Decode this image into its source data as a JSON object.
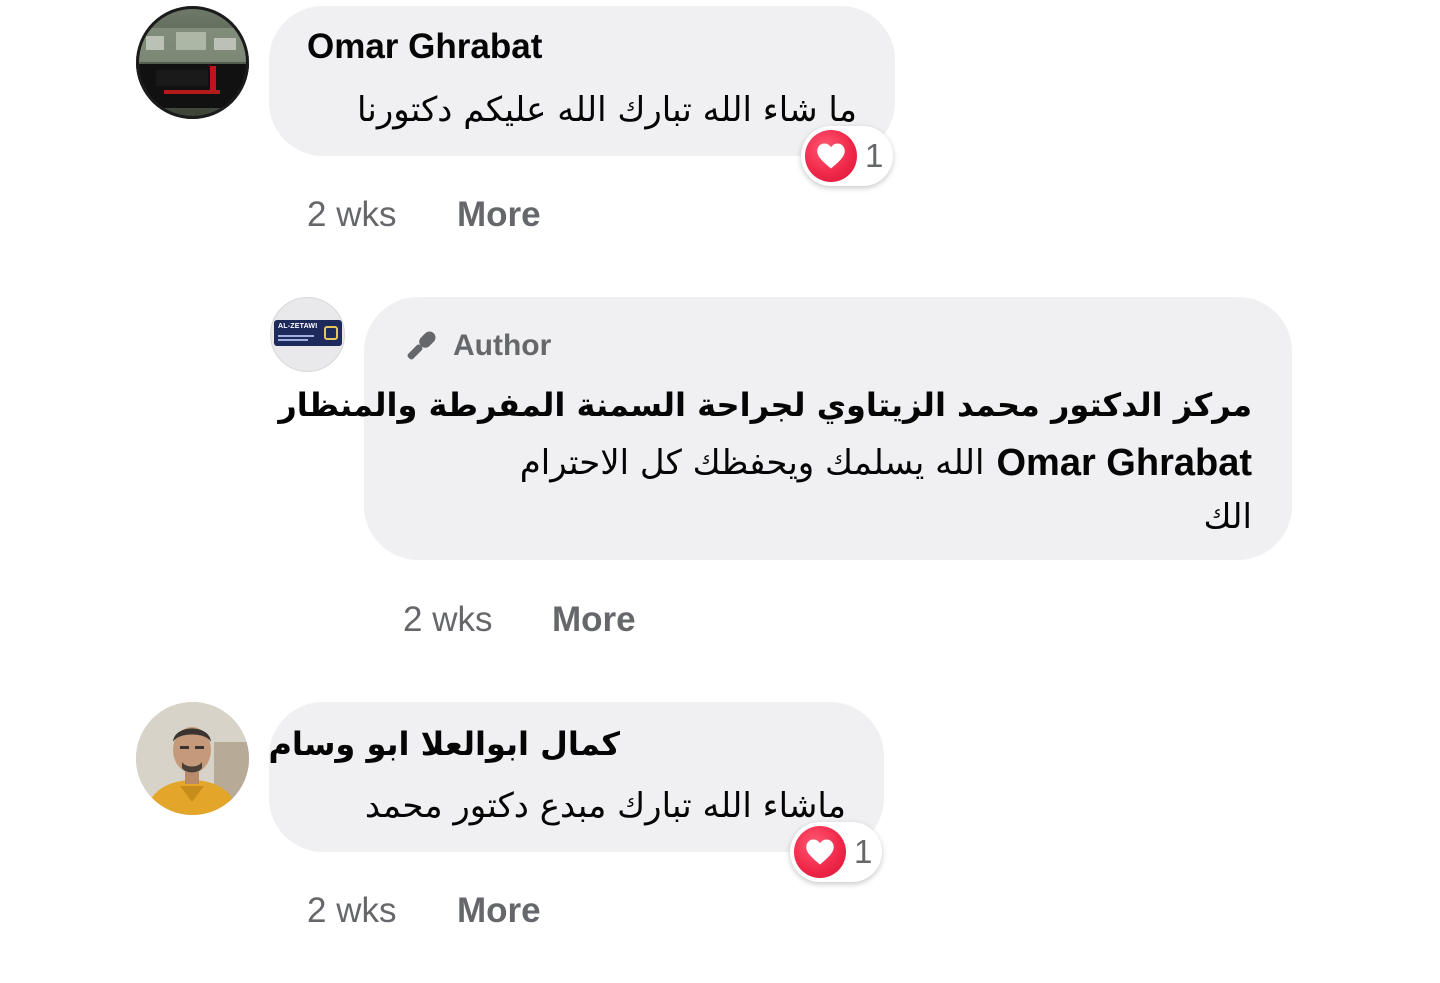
{
  "comments": [
    {
      "author": "Omar Ghrabat",
      "text": "ما شاء الله تبارك الله عليكم دكتورنا",
      "reaction_count": "1",
      "time": "2 wks",
      "more_label": "More"
    },
    {
      "badge_label": "Author",
      "author": "مركز الدكتور محمد الزيتاوي لجراحة السمنة المفرطة والمنظار",
      "mention": "Omar Ghrabat",
      "text_line1": "الله يسلمك ويحفظك كل الاحترام",
      "text_line2": "الك",
      "avatar_text": "AL-ZETAWI",
      "time": "2 wks",
      "more_label": "More"
    },
    {
      "author": "كمال ابوالعلا ابو وسام",
      "text": "ماشاء الله تبارك مبدع دكتور محمد",
      "reaction_count": "1",
      "time": "2 wks",
      "more_label": "More"
    }
  ],
  "colors": {
    "bubble": "#f0f0f2",
    "meta_text": "#65676b",
    "heart": "#f0284a"
  },
  "icons": [
    "heart-icon",
    "microphone-icon"
  ]
}
